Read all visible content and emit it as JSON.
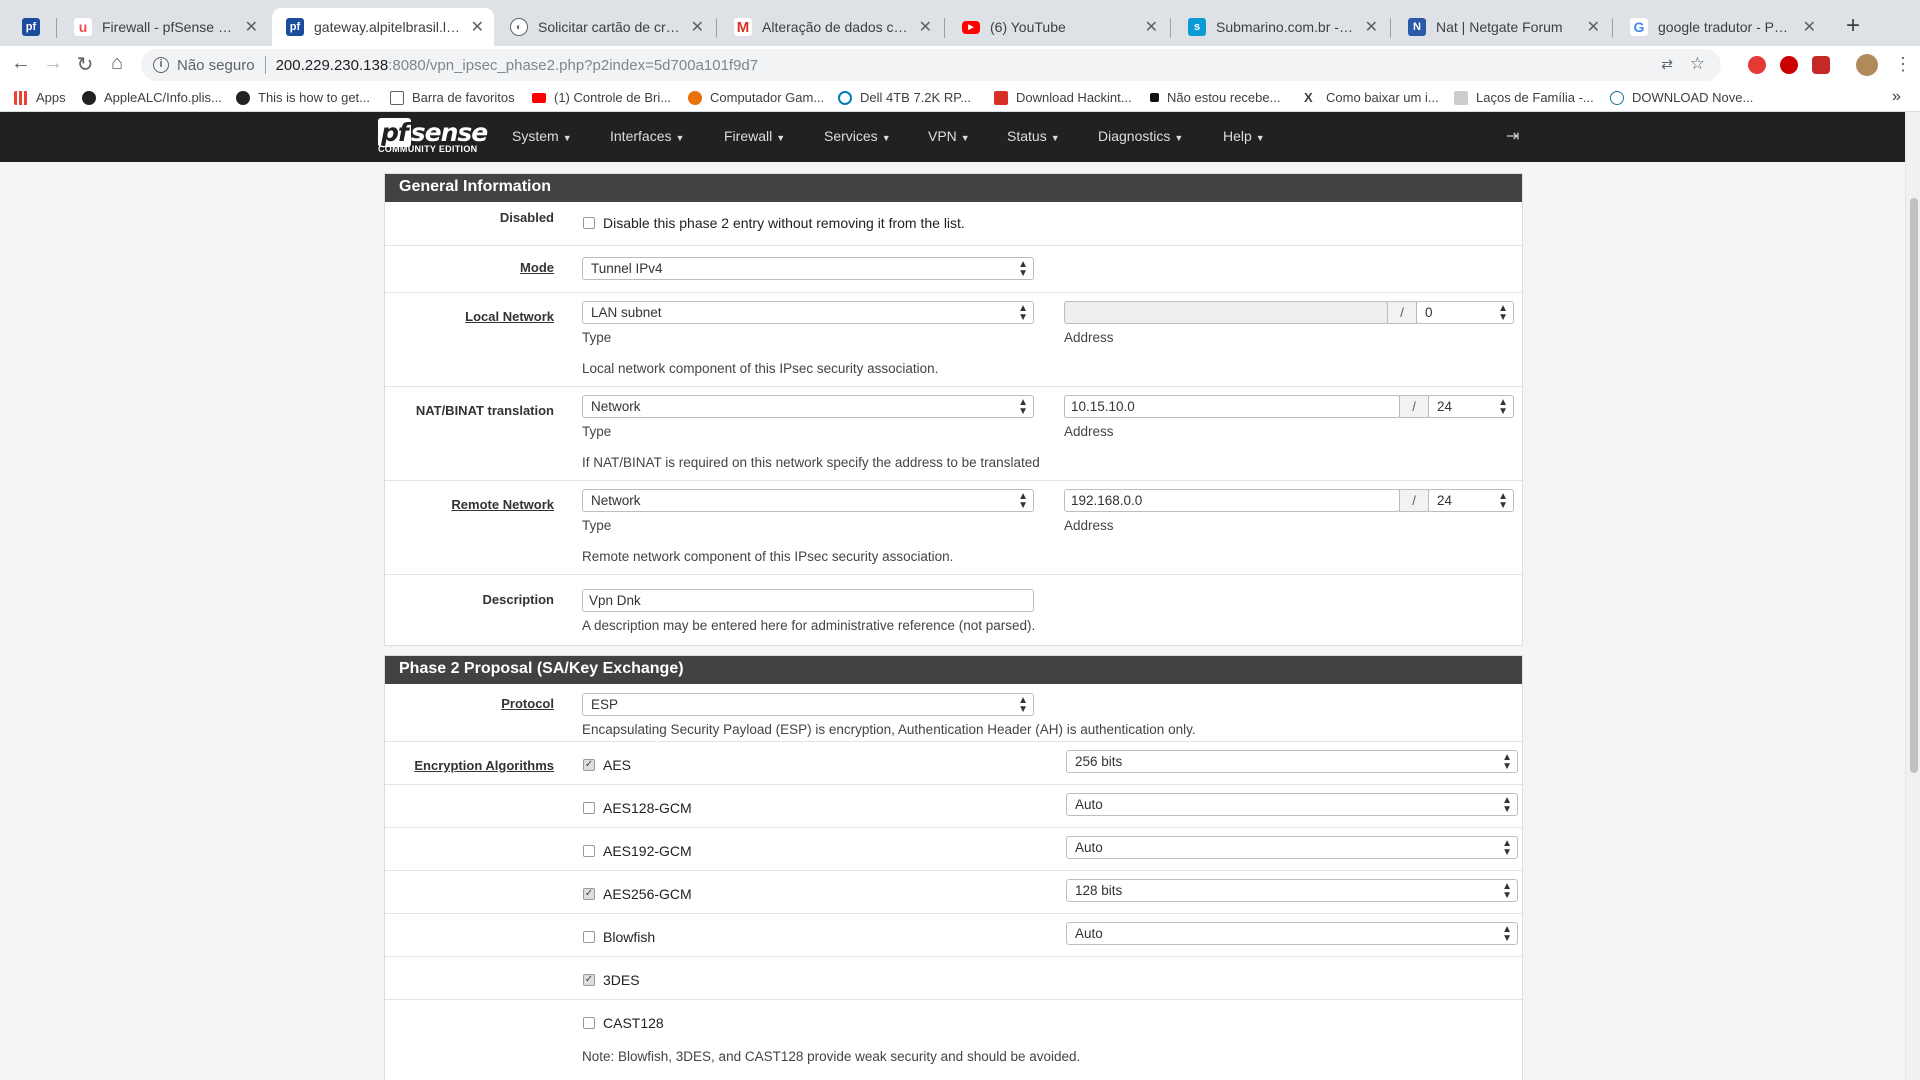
{
  "browser": {
    "tabs": [
      {
        "title": "",
        "favicon": "pfsense-favicon",
        "color": "#1c4c9e"
      },
      {
        "title": "Firewall - pfSense Completo",
        "favicon": "udemy-favicon",
        "color": "#ec5252"
      },
      {
        "title": "gateway.alpitelbrasil.local -",
        "favicon": "pfsense-favicon",
        "color": "#1c4c9e"
      },
      {
        "title": "Solicitar cartão de crédito B",
        "favicon": "globe-favicon",
        "color": "#5f6368"
      },
      {
        "title": "Alteração de dados cadastr",
        "favicon": "gmail-favicon",
        "color": "#d93025"
      },
      {
        "title": "(6) YouTube",
        "favicon": "youtube-favicon",
        "color": "#ff0000"
      },
      {
        "title": "Submarino.com.br - Os proc",
        "favicon": "submarino-favicon",
        "color": "#0a9bd6"
      },
      {
        "title": "Nat | Netgate Forum",
        "favicon": "netgate-favicon",
        "color": "#2a5aa8"
      },
      {
        "title": "google tradutor - Pesquisa",
        "favicon": "google-favicon",
        "color": "#4285f4"
      }
    ],
    "address": {
      "security_label": "Não seguro",
      "host": "200.229.230.138",
      "path": ":8080/vpn_ipsec_phase2.php?p2index=5d700a101f9d7"
    },
    "bookmarks": [
      {
        "label": "Apps",
        "icon": "apps-grid-icon",
        "color": "#ea4335"
      },
      {
        "label": "AppleALC/Info.plis...",
        "icon": "github-icon",
        "color": "#222"
      },
      {
        "label": "This is how to get...",
        "icon": "bookmark-icon",
        "color": "#222"
      },
      {
        "label": "Barra de favoritos",
        "icon": "folder-icon",
        "color": "#5f6368"
      },
      {
        "label": "(1) Controle de Bri...",
        "icon": "youtube-icon",
        "color": "#ff0000"
      },
      {
        "label": "Computador Gam...",
        "icon": "shop-icon",
        "color": "#e8710a"
      },
      {
        "label": "Dell 4TB 7.2K RP...",
        "icon": "dell-icon",
        "color": "#007db8"
      },
      {
        "label": "Download Hackint...",
        "icon": "download-icon",
        "color": "#d93025"
      },
      {
        "label": "Não estou recebe...",
        "icon": "square-icon",
        "color": "#111"
      },
      {
        "label": "Como baixar um i...",
        "icon": "x-icon",
        "color": "#222"
      },
      {
        "label": "Laços de Família -...",
        "icon": "page-icon",
        "color": "#888"
      },
      {
        "label": "DOWNLOAD Nove...",
        "icon": "wordpress-icon",
        "color": "#21759b"
      }
    ],
    "bookmarks_more": "»"
  },
  "pfsense": {
    "logo_text": "sense",
    "logo_pf": "pf",
    "edition": "COMMUNITY EDITION",
    "menu": [
      "System",
      "Interfaces",
      "Firewall",
      "Services",
      "VPN",
      "Status",
      "Diagnostics",
      "Help"
    ]
  },
  "general": {
    "heading": "General Information",
    "disabled": {
      "label": "Disabled",
      "text": "Disable this phase 2 entry without removing it from the list.",
      "checked": false
    },
    "mode": {
      "label": "Mode",
      "value": "Tunnel IPv4"
    },
    "local_network": {
      "label": "Local Network",
      "type_value": "LAN subnet",
      "type_caption": "Type",
      "address": "",
      "mask": "0",
      "address_caption": "Address",
      "help": "Local network component of this IPsec security association."
    },
    "nat": {
      "label": "NAT/BINAT translation",
      "type_value": "Network",
      "type_caption": "Type",
      "address": "10.15.10.0",
      "mask": "24",
      "address_caption": "Address",
      "help": "If NAT/BINAT is required on this network specify the address to be translated"
    },
    "remote_network": {
      "label": "Remote Network",
      "type_value": "Network",
      "type_caption": "Type",
      "address": "192.168.0.0",
      "mask": "24",
      "address_caption": "Address",
      "help": "Remote network component of this IPsec security association."
    },
    "description": {
      "label": "Description",
      "value": "Vpn Dnk",
      "help": "A description may be entered here for administrative reference (not parsed)."
    },
    "slash": "/"
  },
  "phase2": {
    "heading": "Phase 2 Proposal (SA/Key Exchange)",
    "protocol": {
      "label": "Protocol",
      "value": "ESP",
      "help": "Encapsulating Security Payload (ESP) is encryption, Authentication Header (AH) is authentication only."
    },
    "encryption_label": "Encryption Algorithms",
    "algorithms": [
      {
        "name": "AES",
        "checked": true,
        "keylen": "256 bits"
      },
      {
        "name": "AES128-GCM",
        "checked": false,
        "keylen": "Auto"
      },
      {
        "name": "AES192-GCM",
        "checked": false,
        "keylen": "Auto"
      },
      {
        "name": "AES256-GCM",
        "checked": true,
        "keylen": "128 bits"
      },
      {
        "name": "Blowfish",
        "checked": false,
        "keylen": "Auto"
      },
      {
        "name": "3DES",
        "checked": true,
        "keylen": null
      },
      {
        "name": "CAST128",
        "checked": false,
        "keylen": null
      }
    ],
    "note": "Note: Blowfish, 3DES, and CAST128 provide weak security and should be avoided."
  }
}
